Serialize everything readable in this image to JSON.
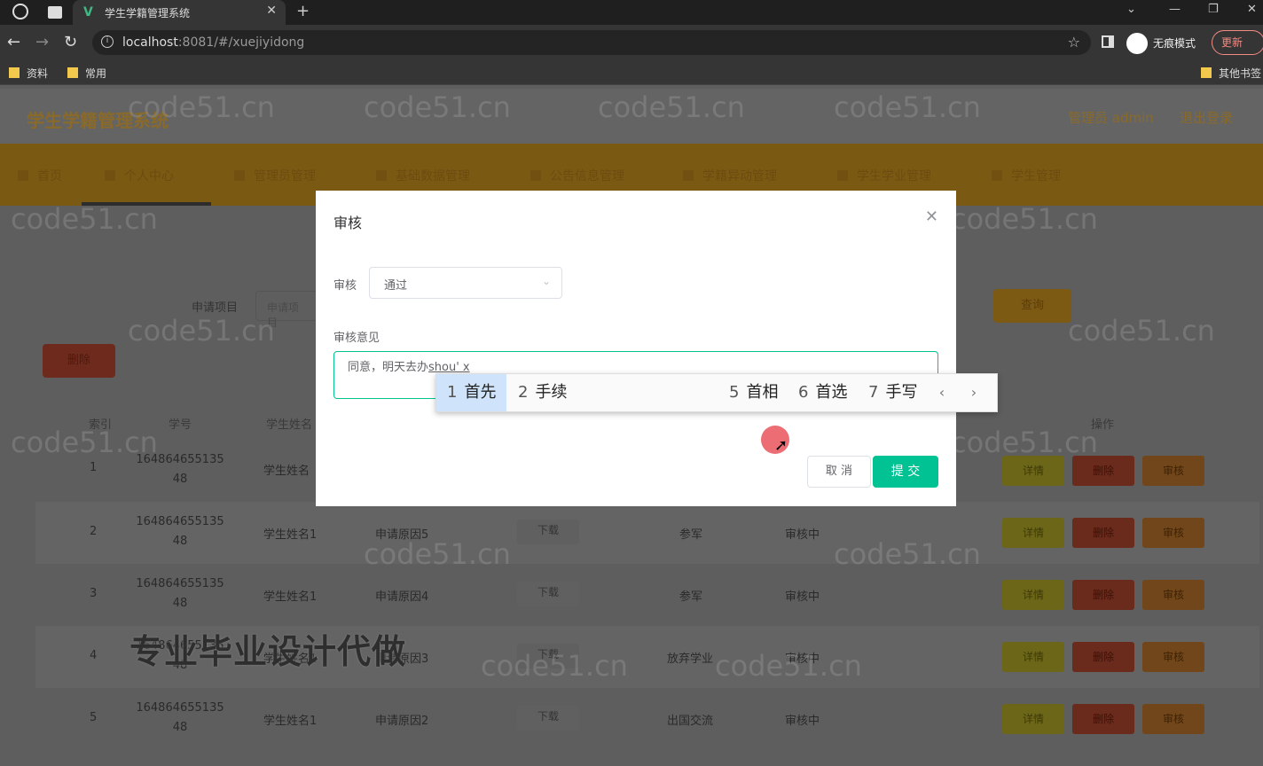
{
  "browser": {
    "tab_title": "学生学籍管理系统",
    "url_host": "localhost",
    "url_rest": ":8081/#/xuejiyidong",
    "incognito_label": "无痕模式",
    "update_label": "更新",
    "bookmarks": [
      "资料",
      "常用"
    ],
    "other_bookmarks": "其他书签"
  },
  "app": {
    "title": "学生学籍管理系统",
    "user_text": "管理员 admin",
    "logout_label": "退出登录",
    "nav": [
      "首页",
      "个人中心",
      "管理员管理",
      "基础数据管理",
      "公告信息管理",
      "学籍异动管理",
      "学生学业管理",
      "学生管理"
    ],
    "search_label": "申请项目",
    "search_placeholder": "申请项目",
    "query_label": "查询",
    "delete_label": "删除",
    "table_headers": [
      "索引",
      "学号",
      "学生姓名",
      "操作"
    ],
    "rows": [
      {
        "index": "1",
        "student_no_1": "164864655135",
        "student_no_2": "48",
        "name": "学生姓名",
        "reason": "",
        "file": "",
        "type": "",
        "status": ""
      },
      {
        "index": "2",
        "student_no_1": "164864655135",
        "student_no_2": "48",
        "name": "学生姓名1",
        "reason": "申请原因5",
        "file": "下载",
        "type": "参军",
        "status": "审核中"
      },
      {
        "index": "3",
        "student_no_1": "164864655135",
        "student_no_2": "48",
        "name": "学生姓名1",
        "reason": "申请原因4",
        "file": "下载",
        "type": "参军",
        "status": "审核中"
      },
      {
        "index": "4",
        "student_no_1": "164864655135",
        "student_no_2": "48",
        "name": "学生姓名1",
        "reason": "申请原因3",
        "file": "下载",
        "type": "放弃学业",
        "status": "审核中"
      },
      {
        "index": "5",
        "student_no_1": "164864655135",
        "student_no_2": "48",
        "name": "学生姓名1",
        "reason": "申请原因2",
        "file": "下载",
        "type": "出国交流",
        "status": "审核中"
      }
    ],
    "row_actions": {
      "detail": "详情",
      "delete": "删除",
      "audit": "审核"
    }
  },
  "dialog": {
    "title": "审核",
    "audit_label": "审核",
    "audit_value": "通过",
    "opinion_label": "审核意见",
    "opinion_text": "同意，明天去办",
    "opinion_pinyin": "shou' x",
    "cancel_label": "取 消",
    "submit_label": "提 交"
  },
  "ime": {
    "candidates": [
      {
        "n": "1",
        "text": "首先"
      },
      {
        "n": "2",
        "text": "手续"
      },
      {
        "n": "5",
        "text": "首相"
      },
      {
        "n": "6",
        "text": "首选"
      },
      {
        "n": "7",
        "text": "手写"
      }
    ]
  },
  "watermark": {
    "site": "code51.cn",
    "promo": "专业毕业设计代做"
  },
  "colors": {
    "accent": "#00c292",
    "nav_bg": "#e8a620",
    "title_color": "#e8a620"
  }
}
